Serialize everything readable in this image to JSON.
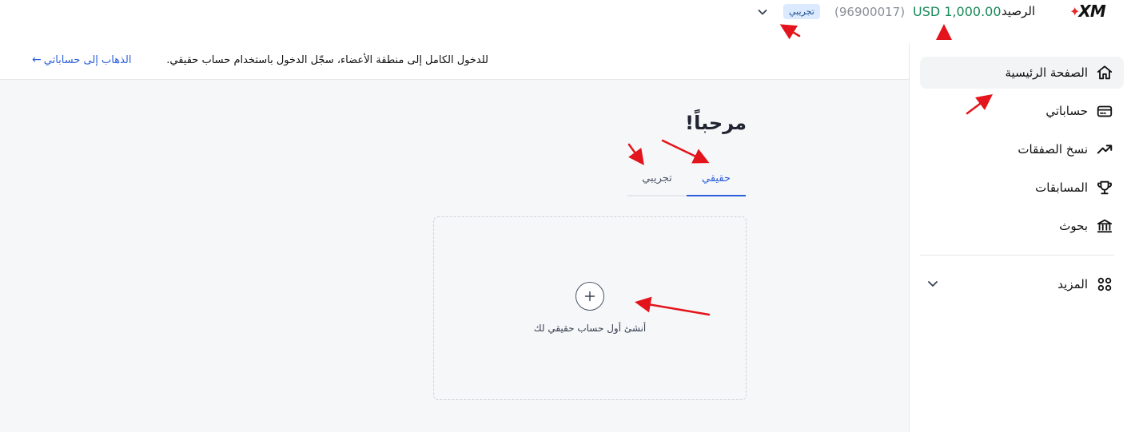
{
  "header": {
    "logo_text": "XM",
    "balance_label": "الرصيد",
    "balance_value": "USD 1,000.00",
    "account_number": "(96900017)",
    "account_type_badge": "تجريبي"
  },
  "sidebar": {
    "items": [
      {
        "label": "الصفحة الرئيسية",
        "icon": "home-icon",
        "active": true
      },
      {
        "label": "حساباتي",
        "icon": "wallet-icon"
      },
      {
        "label": "نسخ الصفقات",
        "icon": "trending-up-icon"
      },
      {
        "label": "المسابقات",
        "icon": "trophy-icon"
      },
      {
        "label": "بحوث",
        "icon": "bank-icon"
      }
    ],
    "more_label": "المزيد",
    "more_icon": "grid-icon"
  },
  "infobar": {
    "message": "للدخول الكامل إلى منطقة الأعضاء، سجّل الدخول باستخدام حساب حقيقي.",
    "link_label": "الذهاب إلى حساباتي"
  },
  "main": {
    "welcome_title": "مرحباً!",
    "tabs": [
      {
        "label": "حقيقي",
        "active": true
      },
      {
        "label": "تجريبي",
        "active": false
      }
    ],
    "create_account_label": "أنشئ أول حساب حقيقي لك"
  },
  "colors": {
    "accent": "#2b5fd9",
    "balance": "#1a8a5a",
    "annotation_arrow": "#e3141b"
  }
}
